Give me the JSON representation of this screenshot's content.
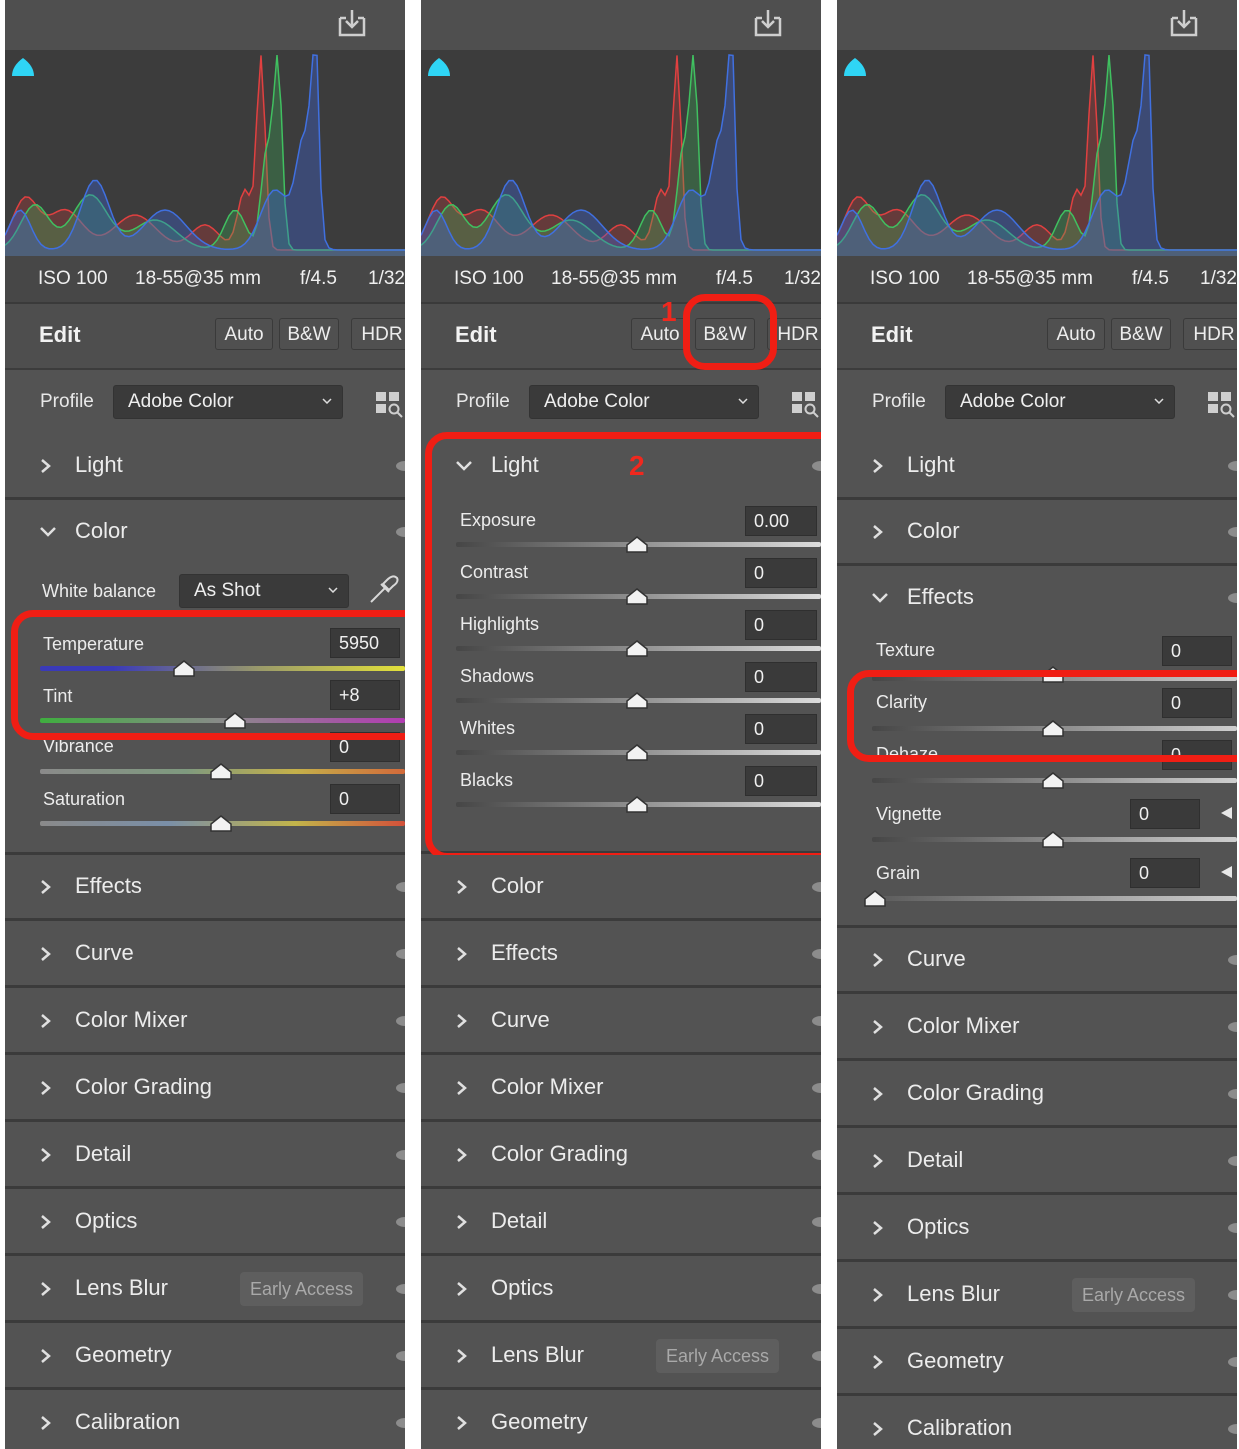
{
  "meta": {
    "iso": "ISO 100",
    "lens": "18-55@35 mm",
    "aperture": "f/4.5",
    "shutter": "1/32"
  },
  "edit": {
    "title": "Edit",
    "auto": "Auto",
    "bw": "B&W",
    "hdr": "HDR"
  },
  "profile": {
    "label": "Profile",
    "value": "Adobe Color"
  },
  "badge": "Early Access",
  "panel1": {
    "light": "Light",
    "color": "Color",
    "white_balance_label": "White balance",
    "white_balance_value": "As Shot",
    "temperature": {
      "label": "Temperature",
      "value": "5950"
    },
    "tint": {
      "label": "Tint",
      "value": "+8"
    },
    "vibrance": {
      "label": "Vibrance",
      "value": "0"
    },
    "saturation": {
      "label": "Saturation",
      "value": "0"
    },
    "sections": [
      "Effects",
      "Curve",
      "Color Mixer",
      "Color Grading",
      "Detail",
      "Optics",
      "Lens Blur",
      "Geometry",
      "Calibration"
    ]
  },
  "panel2": {
    "light": "Light",
    "marker1": "1",
    "marker2": "2",
    "sliders": [
      {
        "label": "Exposure",
        "value": "0.00"
      },
      {
        "label": "Contrast",
        "value": "0"
      },
      {
        "label": "Highlights",
        "value": "0"
      },
      {
        "label": "Shadows",
        "value": "0"
      },
      {
        "label": "Whites",
        "value": "0"
      },
      {
        "label": "Blacks",
        "value": "0"
      }
    ],
    "sections": [
      "Color",
      "Effects",
      "Curve",
      "Color Mixer",
      "Color Grading",
      "Detail",
      "Optics",
      "Lens Blur",
      "Geometry"
    ]
  },
  "panel3": {
    "light": "Light",
    "color": "Color",
    "effects": "Effects",
    "texture": {
      "label": "Texture",
      "value": "0"
    },
    "clarity": {
      "label": "Clarity",
      "value": "0"
    },
    "dehaze": {
      "label": "Dehaze",
      "value": "0"
    },
    "vignette": {
      "label": "Vignette",
      "value": "0"
    },
    "grain": {
      "label": "Grain",
      "value": "0"
    },
    "sections": [
      "Curve",
      "Color Mixer",
      "Color Grading",
      "Detail",
      "Optics",
      "Lens Blur",
      "Geometry",
      "Calibration"
    ]
  },
  "colors": {
    "highlight": "#f01e14",
    "panel": "#535353",
    "histogram_bg": "#3c3c3c",
    "clip_warning": "#2fd5f5"
  }
}
